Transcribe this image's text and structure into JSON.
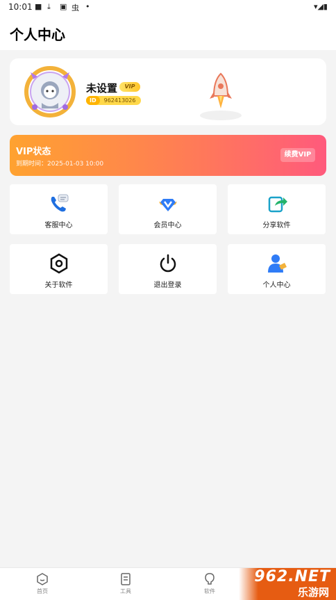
{
  "status_bar": {
    "time": "10:01"
  },
  "header": {
    "title": "个人中心"
  },
  "profile": {
    "username": "未设置",
    "vip_badge": "VIP",
    "id_label": "ID",
    "id_value": "962413026"
  },
  "vip_card": {
    "title": "VIP状态",
    "expire_text": "到期时间：2025-01-03 10:00",
    "renew_label": "续费VIP",
    "gradient_colors": [
      "#ffa230",
      "#ff5a7c"
    ]
  },
  "grid": [
    {
      "label": "客服中心",
      "icon": "customer-service-phone-icon"
    },
    {
      "label": "会员中心",
      "icon": "vip-diamond-icon"
    },
    {
      "label": "分享软件",
      "icon": "share-icon"
    },
    {
      "label": "关于软件",
      "icon": "hexagon-settings-icon"
    },
    {
      "label": "退出登录",
      "icon": "power-icon"
    },
    {
      "label": "个人中心",
      "icon": "user-profile-icon"
    }
  ],
  "bottom_nav": [
    {
      "label": "首页",
      "icon": "home-icon"
    },
    {
      "label": "工具",
      "icon": "tools-icon"
    },
    {
      "label": "软件",
      "icon": "bulb-icon"
    }
  ],
  "watermark": {
    "main": "962.NET",
    "sub": "乐游网"
  }
}
